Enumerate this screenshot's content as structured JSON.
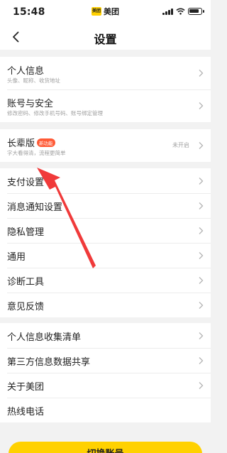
{
  "status_bar": {
    "time": "15:48",
    "app_logo": "美团",
    "app_name": "美团"
  },
  "nav": {
    "title": "设置",
    "back_icon": "chevron-left-icon"
  },
  "group1": [
    {
      "label": "个人信息",
      "sub": "头像、昵称、收货地址"
    },
    {
      "label": "账号与安全",
      "sub": "修改密码、修改手机号码、账号绑定管理"
    }
  ],
  "group2": {
    "label": "长辈版",
    "badge": "新功能",
    "sub": "字大看得清，流程更简单",
    "status": "未开启"
  },
  "group3": [
    {
      "label": "支付设置"
    },
    {
      "label": "消息通知设置"
    },
    {
      "label": "隐私管理"
    },
    {
      "label": "通用"
    },
    {
      "label": "诊断工具"
    },
    {
      "label": "意见反馈"
    }
  ],
  "group4": [
    {
      "label": "个人信息收集清单"
    },
    {
      "label": "第三方信息数据共享"
    },
    {
      "label": "关于美团"
    },
    {
      "label": "热线电话"
    }
  ],
  "bottom_button": {
    "label": "切换账号"
  },
  "colors": {
    "accent": "#ffd100",
    "badge": "#ff5a36",
    "annotation_arrow": "#f03a3a"
  }
}
